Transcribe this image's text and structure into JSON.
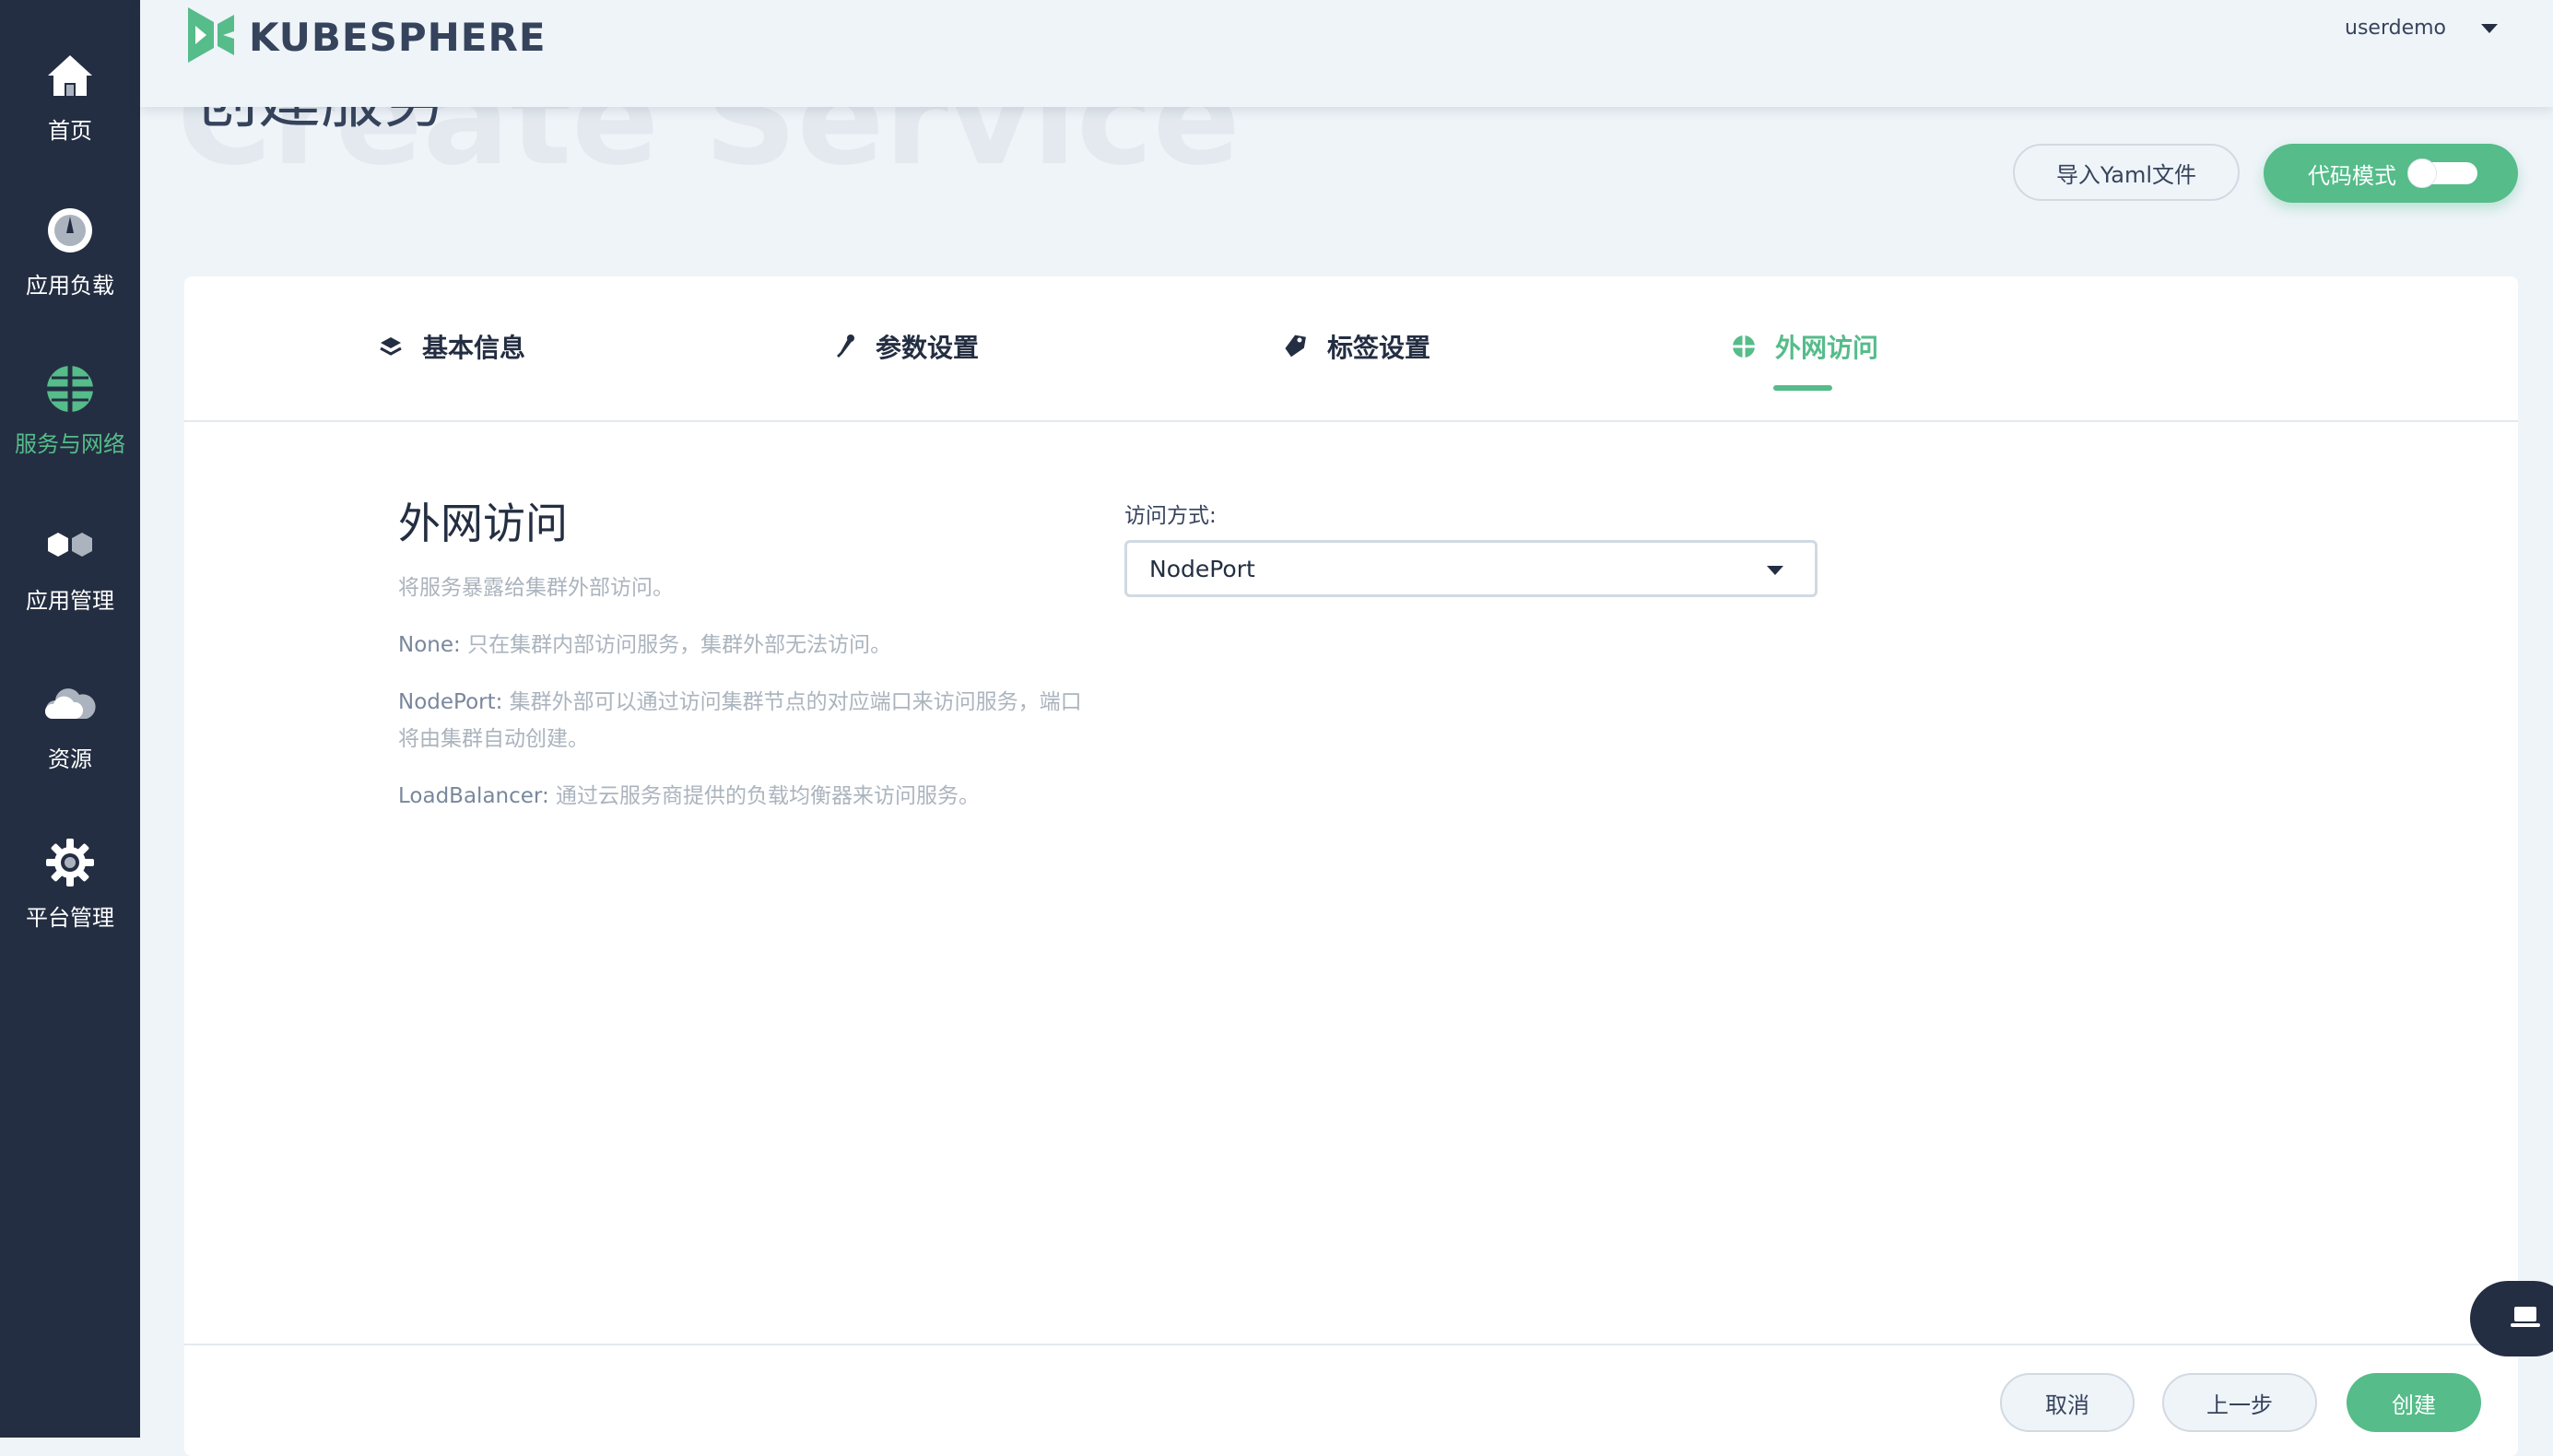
{
  "sidebar": {
    "items": [
      {
        "label": "首页",
        "icon": "home-icon"
      },
      {
        "label": "应用负载",
        "icon": "dashboard-icon"
      },
      {
        "label": "服务与网络",
        "icon": "globe-icon"
      },
      {
        "label": "应用管理",
        "icon": "hexagons-icon"
      },
      {
        "label": "资源",
        "icon": "cloud-icon"
      },
      {
        "label": "平台管理",
        "icon": "gear-icon"
      }
    ],
    "active_index": 2
  },
  "header": {
    "logo_text": "KUBESPHERE",
    "user": "userdemo"
  },
  "page": {
    "bg_title": "Create Service",
    "title": "创建服务",
    "import_yaml_label": "导入Yaml文件",
    "code_mode_label": "代码模式"
  },
  "tabs": [
    {
      "label": "基本信息",
      "icon": "layers-icon"
    },
    {
      "label": "参数设置",
      "icon": "wrench-icon"
    },
    {
      "label": "标签设置",
      "icon": "tag-icon"
    },
    {
      "label": "外网访问",
      "icon": "globe-icon",
      "active": true
    }
  ],
  "section": {
    "title": "外网访问",
    "subtitle": "将服务暴露给集群外部访问。",
    "none_key": "None:",
    "none_text": " 只在集群内部访问服务，集群外部无法访问。",
    "nodeport_key": "NodePort:",
    "nodeport_text": " 集群外部可以通过访问集群节点的对应端口来访问服务，端口将由集群自动创建。",
    "lb_key": "LoadBalancer:",
    "lb_text": " 通过云服务商提供的负载均衡器来访问服务。"
  },
  "form": {
    "access_label": "访问方式:",
    "access_value": "NodePort"
  },
  "footer": {
    "cancel": "取消",
    "prev": "上一步",
    "create": "创建"
  },
  "colors": {
    "accent": "#55bc8a",
    "sidebar_bg": "#242e42",
    "page_bg": "#eff4f9"
  }
}
